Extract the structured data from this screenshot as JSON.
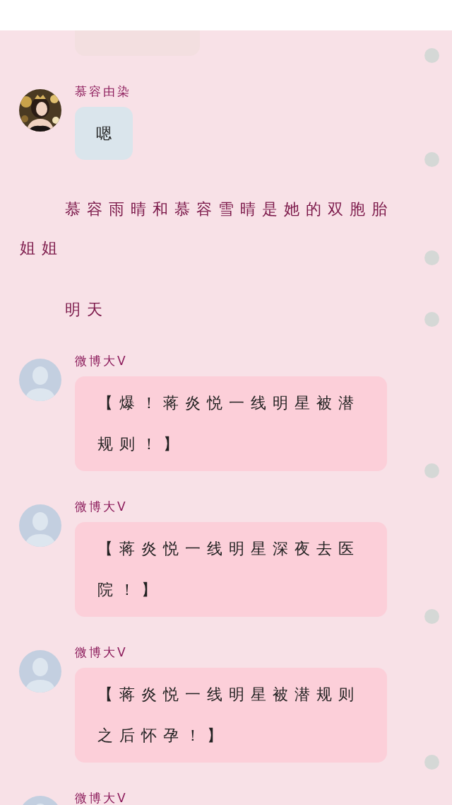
{
  "messages": [
    {
      "kind": "chat",
      "color": "#f3dfe0"
    },
    {
      "kind": "chat",
      "sender": "慕容由染",
      "text": "嗯",
      "color": "#dae5ec"
    },
    {
      "kind": "narration",
      "text": "慕容雨晴和慕容雪晴是她的双胞胎姐姐"
    },
    {
      "kind": "narration",
      "text": "明天"
    },
    {
      "kind": "chat",
      "avatar": {
        "kind": "placeholder"
      },
      "sender": "微博大V",
      "text": "【爆！蒋炎悦一线明星被潜规则！】",
      "color": "#fccfd9"
    },
    {
      "kind": "chat",
      "avatar": {
        "kind": "placeholder"
      },
      "sender": "微博大V",
      "text": "【蒋炎悦一线明星深夜去医院！】",
      "color": "#fccfd9"
    },
    {
      "kind": "chat",
      "avatar": {
        "kind": "placeholder"
      },
      "sender": "微博大V",
      "text": "【蒋炎悦一线明星被潜规则之后怀孕！】",
      "color": "#fccfd9"
    },
    {
      "kind": "chat",
      "avatar": {
        "kind": "placeholder"
      },
      "sender": "微博大V"
    }
  ]
}
